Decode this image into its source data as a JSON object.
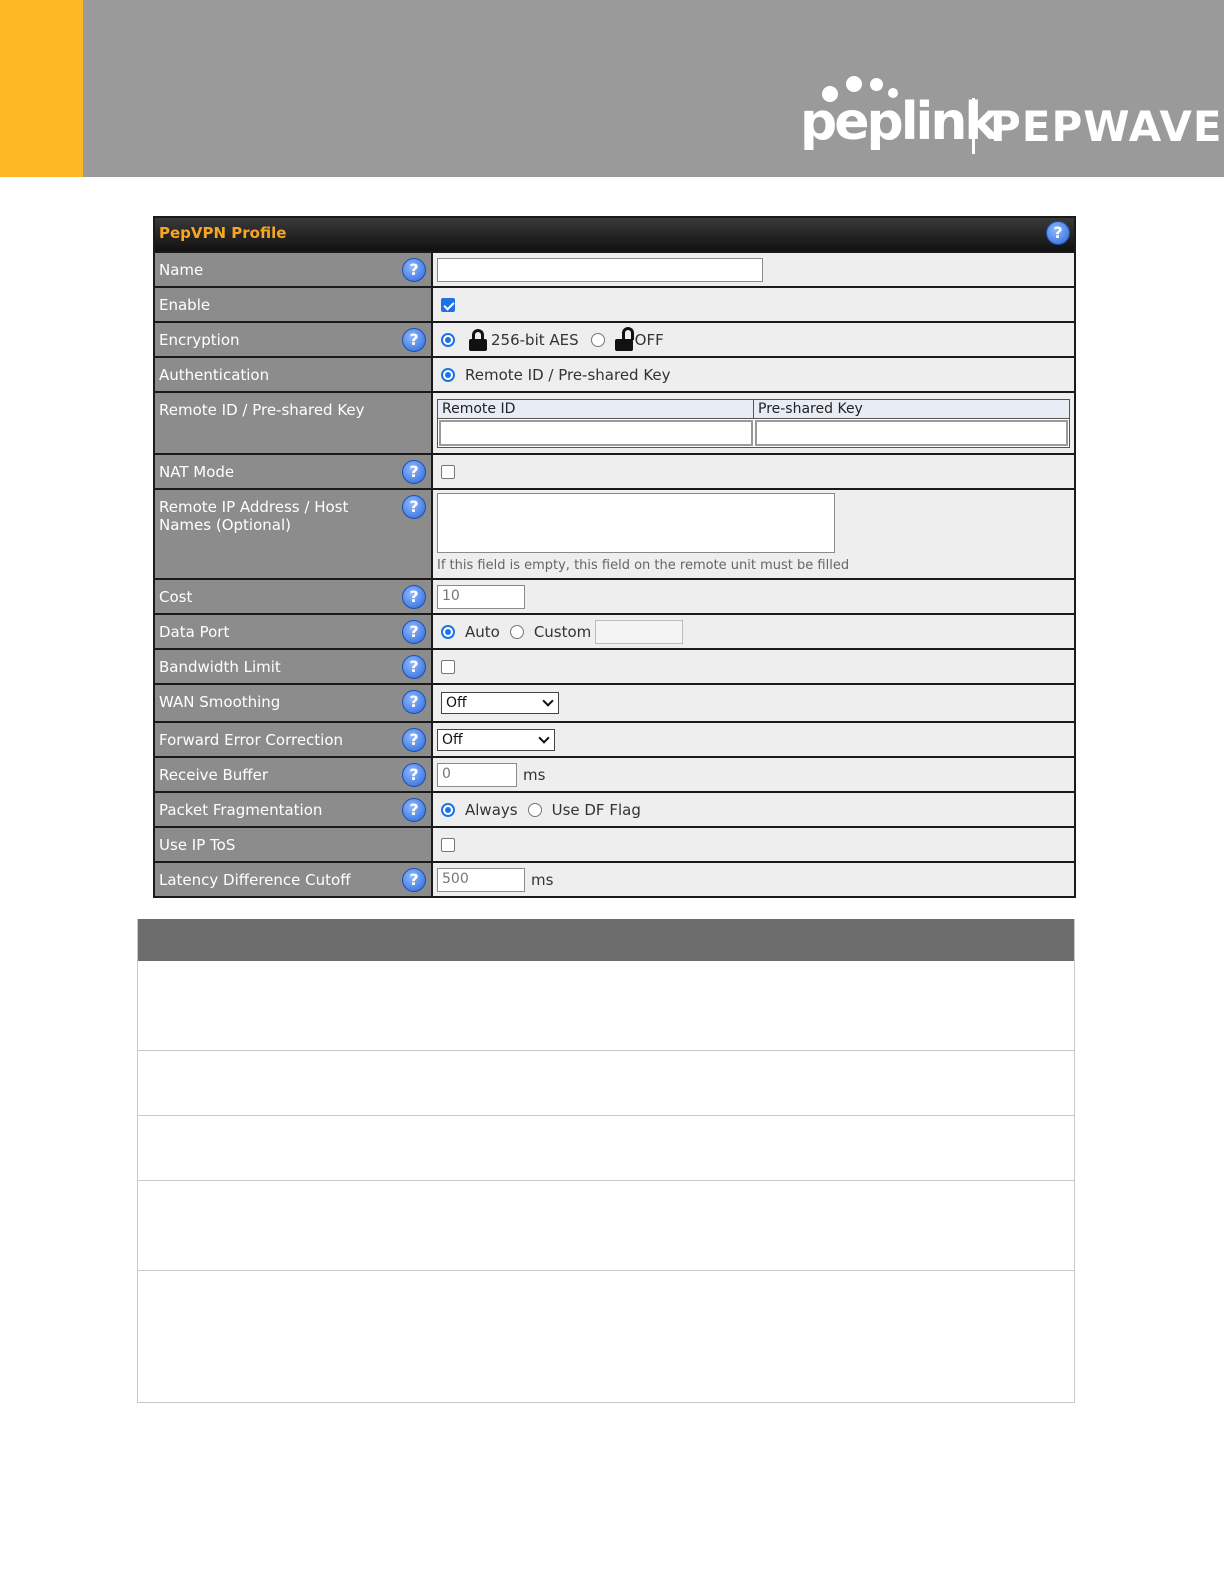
{
  "brand": {
    "logo_primary": "peplink",
    "logo_secondary": "PEPWAVE",
    "accent_color": "#fdb825",
    "banner_color": "#9a9a9a"
  },
  "form": {
    "title": "PepVPN Profile",
    "help_symbol": "?",
    "rows": {
      "name": {
        "label": "Name",
        "value": ""
      },
      "enable": {
        "label": "Enable",
        "checked": true
      },
      "encryption": {
        "label": "Encryption",
        "option_aes": "256-bit AES",
        "option_off": "OFF",
        "selected": "256-bit AES"
      },
      "authentication": {
        "label": "Authentication",
        "option": "Remote ID / Pre-shared Key"
      },
      "remote_id_psk": {
        "label": "Remote ID / Pre-shared Key",
        "col_remote_id": "Remote ID",
        "col_psk": "Pre-shared Key"
      },
      "nat_mode": {
        "label": "NAT Mode",
        "checked": false
      },
      "remote_ip": {
        "label": "Remote IP Address / Host Names (Optional)",
        "hint": "If this field is empty, this field on the remote unit must be filled"
      },
      "cost": {
        "label": "Cost",
        "value": "10"
      },
      "data_port": {
        "label": "Data Port",
        "option_auto": "Auto",
        "option_custom": "Custom",
        "selected": "Auto"
      },
      "bandwidth_limit": {
        "label": "Bandwidth Limit",
        "checked": false
      },
      "wan_smoothing": {
        "label": "WAN Smoothing",
        "value": "Off"
      },
      "fec": {
        "label": "Forward Error Correction",
        "value": "Off"
      },
      "receive_buffer": {
        "label": "Receive Buffer",
        "value": "0",
        "unit": "ms"
      },
      "packet_fragmentation": {
        "label": "Packet Fragmentation",
        "option_always": "Always",
        "option_df": "Use DF Flag",
        "selected": "Always"
      },
      "use_ip_tos": {
        "label": "Use IP ToS",
        "checked": false
      },
      "latency_cutoff": {
        "label": "Latency Difference Cutoff",
        "value": "500",
        "unit": "ms"
      }
    }
  }
}
